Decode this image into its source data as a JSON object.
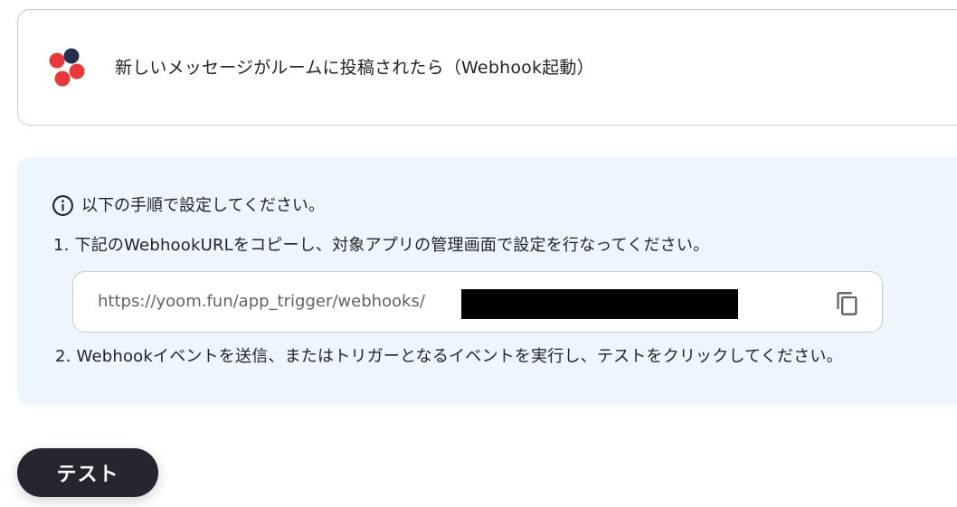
{
  "trigger": {
    "title": "新しいメッセージがルームに投稿されたら（Webhook起動）",
    "app_icon": "chatwork-logo",
    "logo_colors": [
      "#e83a3a",
      "#23314f"
    ]
  },
  "instructions": {
    "heading": "以下の手順で設定してください。",
    "info_icon": "info-circle-icon",
    "step1": "1. 下記のWebhookURLをコピーし、対象アプリの管理画面で設定を行なってください。",
    "webhook_url": "https://yoom.fun/app_trigger/webhooks/",
    "copy_icon": "copy-icon",
    "step2": "2. Webhookイベントを送信、またはトリガーとなるイベントを実行し、テストをクリックしてください。"
  },
  "actions": {
    "test_label": "テスト"
  },
  "colors": {
    "panel_bg": "#eef5fc",
    "button_bg": "#24272e",
    "border": "#c9cbd0"
  }
}
